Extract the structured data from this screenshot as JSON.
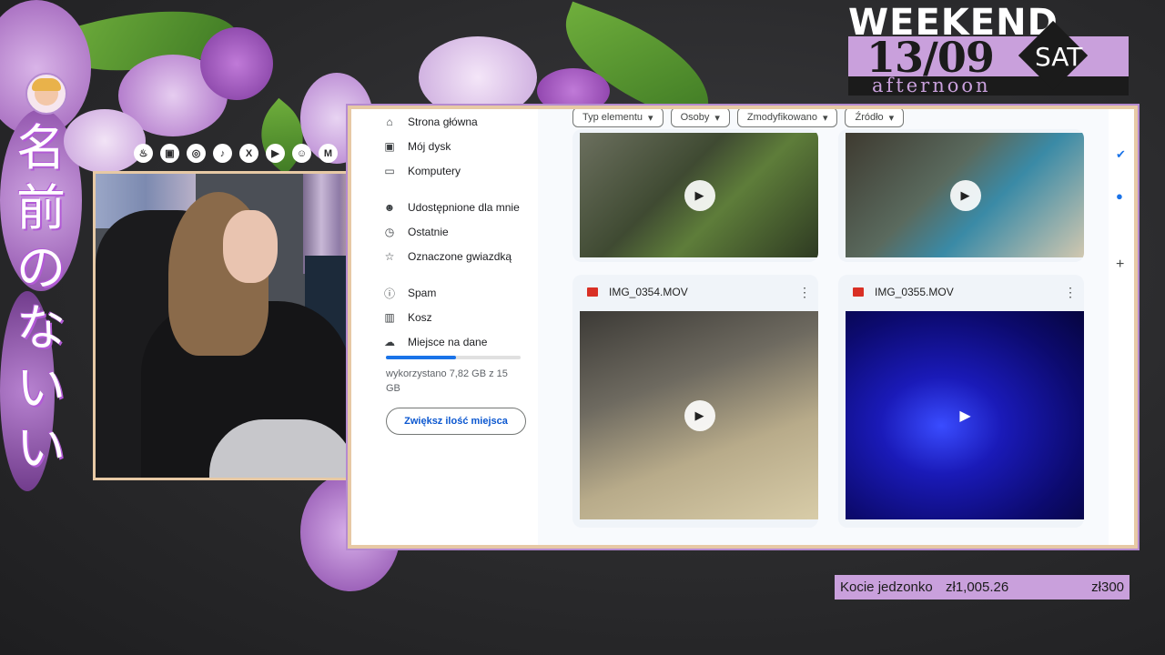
{
  "overlay": {
    "jp_title": [
      "名",
      "前",
      "の",
      "な",
      "い"
    ],
    "socials": [
      "kofi-icon",
      "twitch-icon",
      "instagram-icon",
      "tiktok-icon",
      "x-icon",
      "youtube-icon",
      "discord-icon",
      "gmail-icon"
    ],
    "banner": {
      "word": "WEEKEND",
      "date": "13/09",
      "day": "SAT",
      "sub": "afternoon"
    },
    "donation": {
      "label": "Kocie jedzonko",
      "current": "zł1,005.26",
      "goal": "zł300"
    },
    "colors": {
      "accent": "#c9a0dc",
      "frame": "#e7c9a5"
    }
  },
  "drive": {
    "sidebar": [
      {
        "label": "Strona główna",
        "icon": "home-icon"
      },
      {
        "label": "Mój dysk",
        "icon": "drive-icon"
      },
      {
        "label": "Komputery",
        "icon": "computer-icon"
      },
      {
        "label": "Udostępnione dla mnie",
        "icon": "shared-icon"
      },
      {
        "label": "Ostatnie",
        "icon": "clock-icon"
      },
      {
        "label": "Oznaczone gwiazdką",
        "icon": "star-icon"
      },
      {
        "label": "Spam",
        "icon": "spam-icon"
      },
      {
        "label": "Kosz",
        "icon": "trash-icon"
      },
      {
        "label": "Miejsce na dane",
        "icon": "cloud-icon"
      }
    ],
    "storage": {
      "text": "wykorzystano 7,82 GB z 15 GB",
      "used_fraction": 0.52
    },
    "upgrade_button": "Zwiększ ilość miejsca",
    "filters": [
      "Typ elementu",
      "Osoby",
      "Zmodyfikowano",
      "Źródło"
    ],
    "files": [
      {
        "name": "IMG_0354.MOV"
      },
      {
        "name": "IMG_0355.MOV"
      }
    ]
  }
}
